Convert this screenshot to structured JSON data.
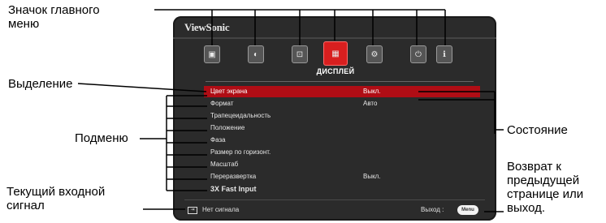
{
  "callouts": {
    "main_icon": "Значок главного\nменю",
    "highlight": "Выделение",
    "submenu": "Подменю",
    "current_input": "Текущий входной\nсигнал",
    "status": "Состояние",
    "return": "Возврат к\nпредыдущей\nстранице или\nвыход."
  },
  "osd": {
    "brand": "ViewSonic",
    "tab_icons": [
      "picture-icon",
      "adjust-icon",
      "source-icon",
      "display-icon",
      "gear-icon",
      "power-icon",
      "info-icon"
    ],
    "active_tab_label": "ДИСПЛЕЙ",
    "rows": [
      {
        "label": "Цвет экрана",
        "value": "Выкл."
      },
      {
        "label": "Формат",
        "value": "Авто"
      },
      {
        "label": "Трапецеидальность",
        "value": ""
      },
      {
        "label": "Положение",
        "value": ""
      },
      {
        "label": "Фаза",
        "value": ""
      },
      {
        "label": "Размер по горизонт.",
        "value": ""
      },
      {
        "label": "Масштаб",
        "value": ""
      },
      {
        "label": "Переразвертка",
        "value": "Выкл."
      },
      {
        "label": "3X Fast Input",
        "value": ""
      }
    ],
    "footer": {
      "no_signal": "Нет сигнала",
      "exit_label": "Выход :",
      "menu_button": "Menu"
    }
  },
  "colors": {
    "osd_background": "#2b2b2b",
    "highlight": "#b00d15",
    "active_tab": "#d81f1f"
  }
}
